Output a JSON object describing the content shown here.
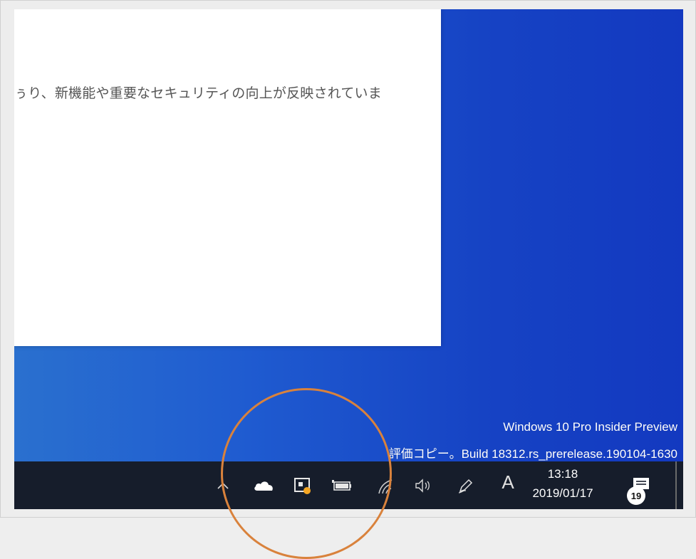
{
  "window": {
    "body_text": "ぅり、新機能や重要なセキュリティの向上が反映されていま"
  },
  "desktop": {
    "watermark_line1": "Windows 10 Pro Insider Preview",
    "watermark_line2": "評価コピー。Build 18312.rs_prerelease.190104-1630"
  },
  "taskbar": {
    "tray_icons": [
      "chevron-up-icon",
      "onedrive-cloud-icon",
      "security-app-icon",
      "battery-icon",
      "wifi-icon",
      "volume-icon",
      "pen-icon"
    ],
    "ime_label": "A",
    "time": "13:18",
    "date": "2019/01/17",
    "notification_count": "19"
  },
  "colors": {
    "taskbar": "#161d2b",
    "desktop": "#1f5bd0",
    "annotation_ring": "#d9823c",
    "notification_dot": "#f5a623"
  }
}
